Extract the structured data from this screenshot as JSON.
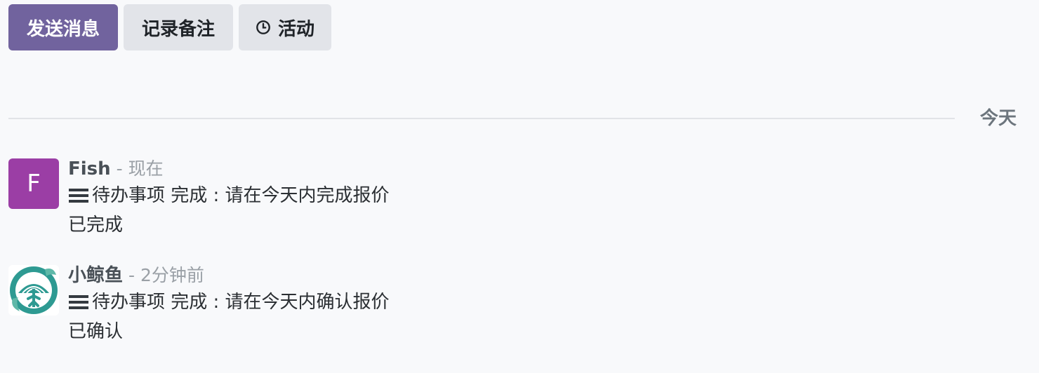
{
  "toolbar": {
    "send_message": "发送消息",
    "log_note": "记录备注",
    "activity": "活动"
  },
  "divider": {
    "label": "今天"
  },
  "messages": [
    {
      "avatar_letter": "F",
      "author": "Fish",
      "time": "- 现在",
      "activity_line": "待办事项 完成 : 请在今天内完成报价",
      "feedback": "已完成"
    },
    {
      "avatar_letter": "",
      "author": "小鲸鱼",
      "time": "- 2分钟前",
      "activity_line": "待办事项 完成 : 请在今天内确认报价",
      "feedback": "已确认"
    }
  ],
  "colors": {
    "primary": "#71639e",
    "secondary": "#e2e4e9",
    "avatar_f": "#9b3ea5",
    "avatar_teal": "#2e9a92"
  },
  "icons": {
    "activity": "clock-icon",
    "todo": "list-icon"
  }
}
